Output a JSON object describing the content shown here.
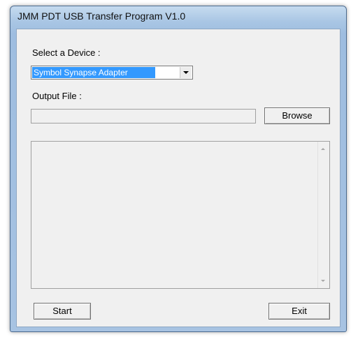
{
  "window": {
    "title": "JMM PDT USB Transfer Program V1.0"
  },
  "device": {
    "label": "Select a Device :",
    "selected": "Symbol Synapse Adapter"
  },
  "output": {
    "label": "Output File :",
    "value": "",
    "browse_label": "Browse"
  },
  "log": {
    "text": ""
  },
  "footer": {
    "start_label": "Start",
    "exit_label": "Exit"
  },
  "icons": {
    "combo_arrow": "chevron-down-icon",
    "scroll_up": "scroll-up-arrow-icon",
    "scroll_down": "scroll-down-arrow-icon"
  },
  "colors": {
    "selection": "#3399ff",
    "client_background": "#f0f0f0",
    "titlebar": "#a9c6e4"
  }
}
